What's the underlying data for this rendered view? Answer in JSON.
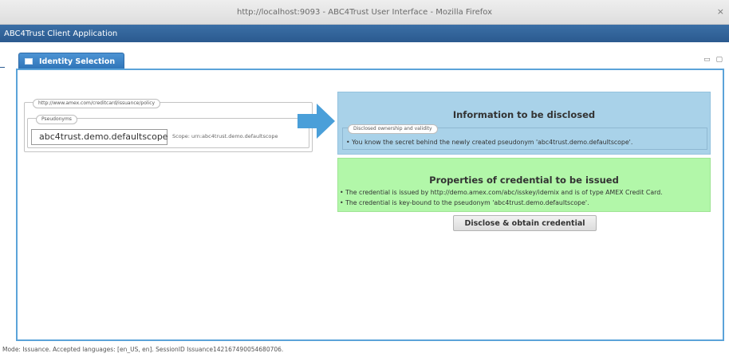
{
  "window": {
    "title": "http://localhost:9093 - ABC4Trust User Interface - Mozilla Firefox",
    "close_glyph": "×"
  },
  "app": {
    "title": "ABC4Trust Client Application"
  },
  "portlet": {
    "tab_label": "Identity Selection",
    "controls": "▭ ▢"
  },
  "policy": {
    "uri": "http://www.amex.com/creditcard/issuance/policy",
    "pseudonyms_label": "Pseudonyms",
    "pseudonym_value": "abc4trust.demo.defaultscope",
    "scope_text": "Scope: urn:abc4trust.demo.defaultscope"
  },
  "disclosure": {
    "title": "Information to be disclosed",
    "section_label": "Disclosed ownership and validity",
    "item": "• You know the secret behind the newly created pseudonym 'abc4trust.demo.defaultscope'."
  },
  "issuance": {
    "title": "Properties of credential to be issued",
    "items": [
      "• The credential is issued by http://demo.amex.com/abc/isskey/idemix and is of type AMEX Credit Card.",
      "• The credential is key-bound to the pseudonym 'abc4trust.demo.defaultscope'."
    ],
    "submit_label": "Disclose & obtain credential"
  },
  "status": {
    "text": "Mode: Issuance. Accepted languages: [en_US, en]. SessionID Issuance142167490054680706."
  },
  "colors": {
    "appbar": "#2b5a8f",
    "tab": "#3a80c2",
    "border": "#5ba3d9",
    "disclosure_bg": "#a9d2e9",
    "issuance_bg": "#b2f7a9",
    "arrow": "#4a9fd9"
  }
}
